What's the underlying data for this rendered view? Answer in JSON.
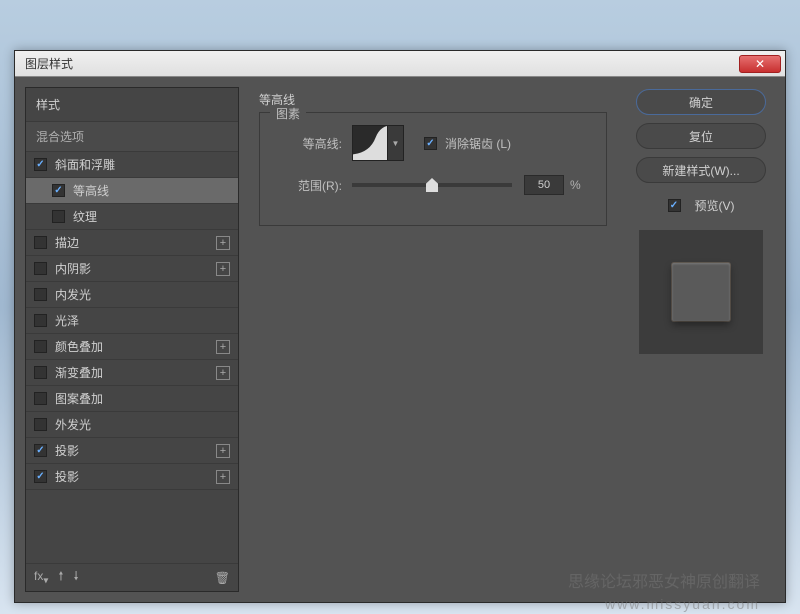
{
  "window": {
    "title": "图层样式"
  },
  "styles_panel": {
    "header": "样式",
    "blend_options": "混合选项",
    "items": [
      {
        "label": "斜面和浮雕",
        "checked": true,
        "indent": false,
        "has_add": false,
        "selected": false
      },
      {
        "label": "等高线",
        "checked": true,
        "indent": true,
        "has_add": false,
        "selected": true
      },
      {
        "label": "纹理",
        "checked": false,
        "indent": true,
        "has_add": false,
        "selected": false
      },
      {
        "label": "描边",
        "checked": false,
        "indent": false,
        "has_add": true,
        "selected": false
      },
      {
        "label": "内阴影",
        "checked": false,
        "indent": false,
        "has_add": true,
        "selected": false
      },
      {
        "label": "内发光",
        "checked": false,
        "indent": false,
        "has_add": false,
        "selected": false
      },
      {
        "label": "光泽",
        "checked": false,
        "indent": false,
        "has_add": false,
        "selected": false
      },
      {
        "label": "颜色叠加",
        "checked": false,
        "indent": false,
        "has_add": true,
        "selected": false
      },
      {
        "label": "渐变叠加",
        "checked": false,
        "indent": false,
        "has_add": true,
        "selected": false
      },
      {
        "label": "图案叠加",
        "checked": false,
        "indent": false,
        "has_add": false,
        "selected": false
      },
      {
        "label": "外发光",
        "checked": false,
        "indent": false,
        "has_add": false,
        "selected": false
      },
      {
        "label": "投影",
        "checked": true,
        "indent": false,
        "has_add": true,
        "selected": false
      },
      {
        "label": "投影",
        "checked": true,
        "indent": false,
        "has_add": true,
        "selected": false
      }
    ],
    "footer_fx": "fx"
  },
  "settings": {
    "title": "等高线",
    "fieldset_legend": "图素",
    "contour_label": "等高线:",
    "antialias_label": "消除锯齿 (L)",
    "antialias_checked": true,
    "range_label": "范围(R):",
    "range_value": "50",
    "range_unit": "%",
    "range_slider_pos": 50
  },
  "right": {
    "ok": "确定",
    "cancel": "复位",
    "new_style": "新建样式(W)...",
    "preview_label": "预览(V)",
    "preview_checked": true
  },
  "watermark": {
    "line1": "思缘论坛邪恶女神原创翻译",
    "line2": "www.missyuan.com"
  }
}
